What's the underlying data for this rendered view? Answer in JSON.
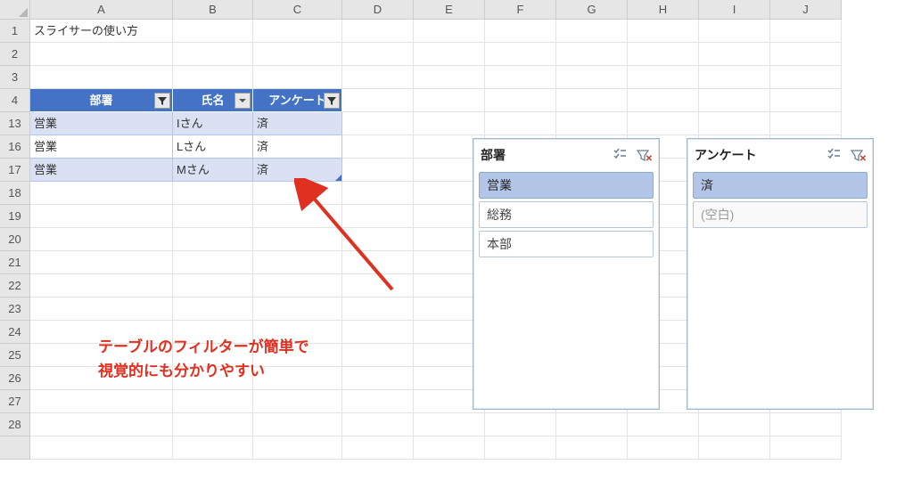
{
  "columns": [
    "A",
    "B",
    "C",
    "D",
    "E",
    "F",
    "G",
    "H",
    "I",
    "J"
  ],
  "rows_visible": [
    "1",
    "2",
    "3",
    "4",
    "13",
    "16",
    "17",
    "18",
    "19",
    "20",
    "21",
    "22",
    "23",
    "24",
    "25",
    "26",
    "27",
    "28"
  ],
  "cell_A1": "スライサーの使い方",
  "table": {
    "headers": {
      "col1": "部署",
      "col2": "氏名",
      "col3": "アンケート"
    },
    "rows": [
      {
        "rn": "13",
        "c1": "営業",
        "c2": "Iさん",
        "c3": "済"
      },
      {
        "rn": "16",
        "c1": "営業",
        "c2": "Lさん",
        "c3": "済"
      },
      {
        "rn": "17",
        "c1": "営業",
        "c2": "Mさん",
        "c3": "済"
      }
    ]
  },
  "slicers": [
    {
      "title": "部署",
      "items": [
        {
          "label": "営業",
          "selected": true
        },
        {
          "label": "総務",
          "selected": false
        },
        {
          "label": "本部",
          "selected": false
        }
      ]
    },
    {
      "title": "アンケート",
      "items": [
        {
          "label": "済",
          "selected": true
        },
        {
          "label": "(空白)",
          "selected": false,
          "dim": true
        }
      ]
    }
  ],
  "annotation": {
    "line1": "テーブルのフィルターが簡単で",
    "line2": "視覚的にも分かりやすい"
  }
}
